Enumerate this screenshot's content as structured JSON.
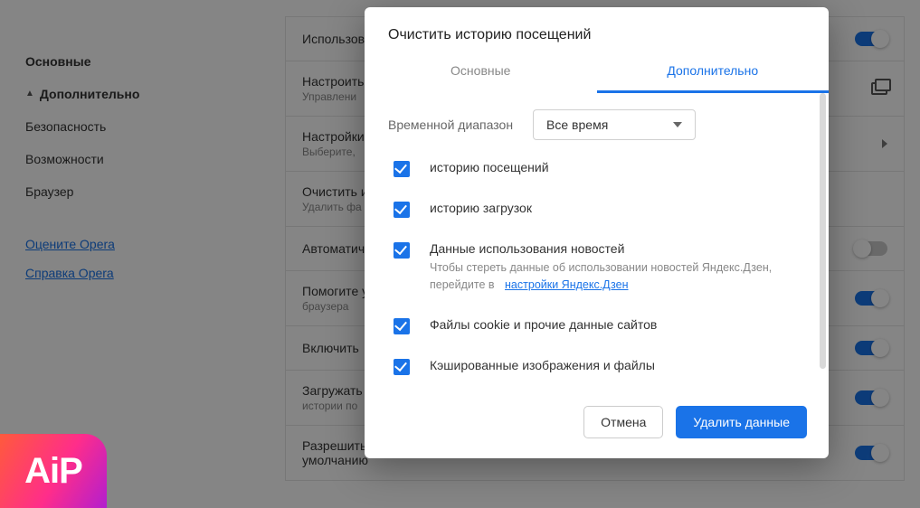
{
  "sidebar": {
    "items": [
      {
        "label": "Основные"
      },
      {
        "label": "Дополнительно"
      },
      {
        "label": "Безопасность"
      },
      {
        "label": "Возможности"
      },
      {
        "label": "Браузер"
      }
    ],
    "rate_label": "Оцените Opera",
    "help_label": "Справка Opera"
  },
  "settings_rows": [
    {
      "title": "Использовать",
      "toggle": "on"
    },
    {
      "title": "Настроить",
      "sub": "Управлени",
      "icon": "external"
    },
    {
      "title": "Настройки",
      "sub": "Выберите,",
      "icon": "arrow"
    },
    {
      "title": "Очистить и",
      "sub": "Удалить фа"
    },
    {
      "title": "Автоматич",
      "toggle": "off"
    },
    {
      "title": "Помогите улучшить",
      "sub": "браузера",
      "toggle": "on"
    },
    {
      "title": "Включить",
      "toggle": "on"
    },
    {
      "title": "Загружать",
      "sub": "истории по",
      "toggle": "on"
    },
    {
      "title": "Разрешить партнерским поисковым системам проверять, установлены ли они по умолчанию",
      "toggle": "on"
    }
  ],
  "modal": {
    "title": "Очистить историю посещений",
    "tabs": {
      "basic": "Основные",
      "advanced": "Дополнительно"
    },
    "time_label": "Временной диапазон",
    "time_value": "Все время",
    "items": [
      {
        "label": "историю посещений"
      },
      {
        "label": "историю загрузок"
      },
      {
        "label": "Данные использования новостей",
        "sub_a": "Чтобы стереть данные об использовании новостей Яндекс.Дзен, перейдите в",
        "sub_link": "настройки Яндекс.Дзен"
      },
      {
        "label": "Файлы cookie и прочие данные сайтов"
      },
      {
        "label": "Кэшированные изображения и файлы"
      }
    ],
    "cancel": "Отмена",
    "confirm": "Удалить данные"
  },
  "badge": "AiP"
}
